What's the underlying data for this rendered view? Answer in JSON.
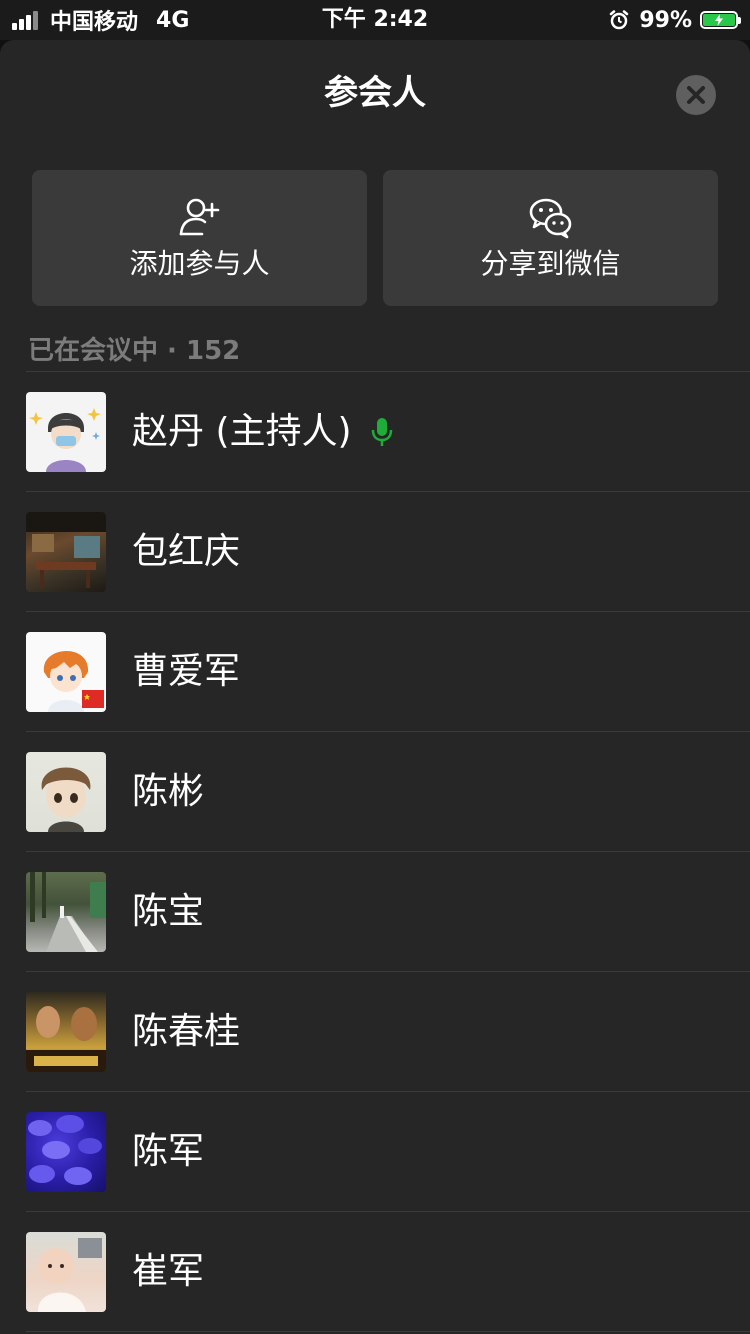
{
  "status_bar": {
    "carrier": "中国移动",
    "network": "4G",
    "time": "下午 2:42",
    "battery": "99%",
    "battery_color": "#2ac84a"
  },
  "header": {
    "title": "参会人",
    "close_icon": "close-icon"
  },
  "actions": [
    {
      "label": "添加参与人",
      "icon": "add-person-icon"
    },
    {
      "label": "分享到微信",
      "icon": "wechat-icon"
    }
  ],
  "in_meeting": {
    "label": "已在会议中 · 152"
  },
  "participants": [
    {
      "name": "赵丹 (主持人)",
      "speaking": true
    },
    {
      "name": "包红庆"
    },
    {
      "name": "曹爱军"
    },
    {
      "name": "陈彬"
    },
    {
      "name": "陈宝"
    },
    {
      "name": "陈春桂"
    },
    {
      "name": "陈军"
    },
    {
      "name": "崔军"
    }
  ],
  "colors": {
    "sheet_background": "#262626",
    "button_background": "#3a3a3a",
    "mic_active": "#1fad3a",
    "muted_text": "#7c7c7c"
  }
}
